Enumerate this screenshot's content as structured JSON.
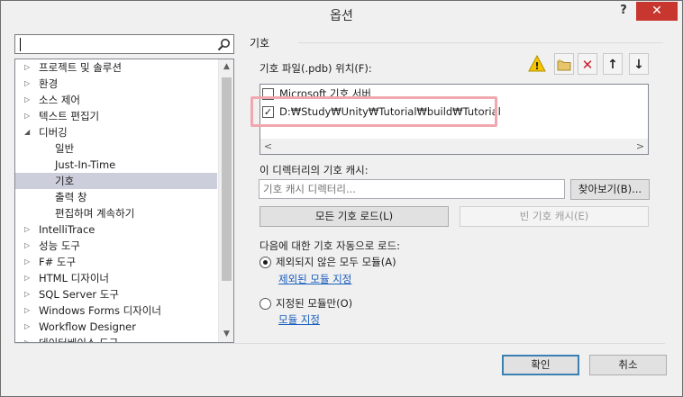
{
  "window": {
    "title": "옵션",
    "help_label": "?",
    "close_label": "✕"
  },
  "search": {
    "value": "",
    "placeholder": ""
  },
  "tree": {
    "items": [
      {
        "label": "프로젝트 및 솔루션",
        "level": 0,
        "expander": "▷",
        "selected": false
      },
      {
        "label": "환경",
        "level": 0,
        "expander": "▷",
        "selected": false
      },
      {
        "label": "소스 제어",
        "level": 0,
        "expander": "▷",
        "selected": false
      },
      {
        "label": "텍스트 편집기",
        "level": 0,
        "expander": "▷",
        "selected": false
      },
      {
        "label": "디버깅",
        "level": 0,
        "expander": "◢",
        "selected": false
      },
      {
        "label": "일반",
        "level": 1,
        "expander": "",
        "selected": false
      },
      {
        "label": "Just-In-Time",
        "level": 1,
        "expander": "",
        "selected": false
      },
      {
        "label": "기호",
        "level": 1,
        "expander": "",
        "selected": true
      },
      {
        "label": "출력 창",
        "level": 1,
        "expander": "",
        "selected": false
      },
      {
        "label": "편집하며 계속하기",
        "level": 1,
        "expander": "",
        "selected": false
      },
      {
        "label": "IntelliTrace",
        "level": 0,
        "expander": "▷",
        "selected": false
      },
      {
        "label": "성능 도구",
        "level": 0,
        "expander": "▷",
        "selected": false
      },
      {
        "label": "F# 도구",
        "level": 0,
        "expander": "▷",
        "selected": false
      },
      {
        "label": "HTML 디자이너",
        "level": 0,
        "expander": "▷",
        "selected": false
      },
      {
        "label": "SQL Server 도구",
        "level": 0,
        "expander": "▷",
        "selected": false
      },
      {
        "label": "Windows Forms 디자이너",
        "level": 0,
        "expander": "▷",
        "selected": false
      },
      {
        "label": "Workflow Designer",
        "level": 0,
        "expander": "▷",
        "selected": false
      },
      {
        "label": "데이터베이스 도구",
        "level": 0,
        "expander": "▷",
        "selected": false
      }
    ],
    "scroll_up": "▲",
    "scroll_down": "▼"
  },
  "symbols": {
    "section_title": "기호",
    "locations_label": "기호 파일(.pdb) 위치(F):",
    "toolbar": {
      "warning": "!",
      "new_folder": "▭",
      "delete": "✕",
      "move_up": "↑",
      "move_down": "↓"
    },
    "locations": [
      {
        "label": "Microsoft 기호 서버",
        "checked": false,
        "check_mark": ""
      },
      {
        "label": "D:₩Study₩Unity₩Tutorial₩build₩Tutorial",
        "checked": true,
        "check_mark": "✓"
      }
    ],
    "hscroll_left": "<",
    "hscroll_right": ">",
    "cache_label": "이 디렉터리의 기호 캐시:",
    "cache_placeholder": "기호 캐시 디렉터리...",
    "browse_button": "찾아보기(B)...",
    "load_all_button": "모든 기호 로드(L)",
    "empty_cache_button": "빈 기호 캐시(E)",
    "auto_load_label": "다음에 대한 기호 자동으로 로드:",
    "radio_all": "제외되지 않은 모두 모듈(A)",
    "link_excluded": "제외된 모듈 지정",
    "radio_specified": "지정된 모듈만(O)",
    "link_specify": "모듈 지정"
  },
  "dialog_buttons": {
    "ok": "확인",
    "cancel": "취소"
  },
  "colors": {
    "accent": "#3c7fb1",
    "close_red": "#c7372f",
    "highlight": "#f1a7ae",
    "link": "#1a5ebd",
    "selected_row": "#cccedb"
  }
}
